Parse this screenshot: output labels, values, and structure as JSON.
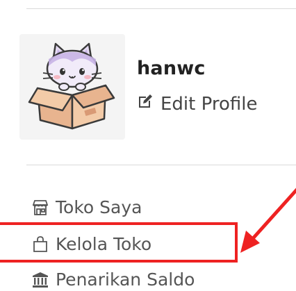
{
  "profile": {
    "username": "hanwc",
    "edit_label": "Edit Profile",
    "avatar_icon": "cat-in-box-avatar",
    "edit_icon": "edit-icon"
  },
  "menu": {
    "items": [
      {
        "label": "Toko Saya",
        "icon": "store-icon"
      },
      {
        "label": "Kelola Toko",
        "icon": "bag-icon"
      },
      {
        "label": "Penarikan Saldo",
        "icon": "bank-icon"
      }
    ]
  },
  "annotation": {
    "color": "#ee2222",
    "highlighted_item": "Kelola Toko"
  }
}
